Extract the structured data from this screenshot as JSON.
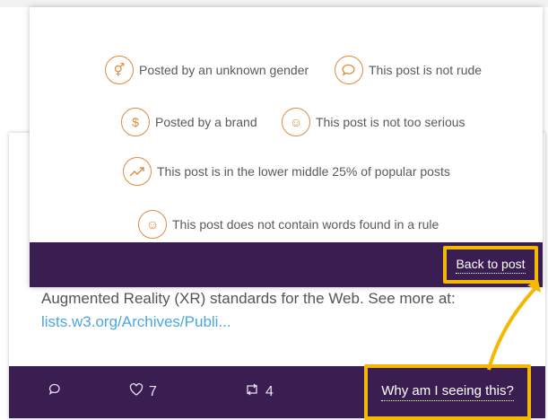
{
  "reasons": {
    "gender": "Posted by an unknown gender",
    "rude": "This post is not rude",
    "brand": "Posted by a brand",
    "serious": "This post is not too serious",
    "popular": "This post is in the lower middle 25% of popular posts",
    "rule": "This post does not contain words found in a rule"
  },
  "modal": {
    "back_label": "Back to post"
  },
  "post": {
    "text_line": "Augmented Reality (XR) standards for the Web. See more at:",
    "link": "lists.w3.org/Archives/Publi..."
  },
  "footer": {
    "like_count": "7",
    "repost_count": "4",
    "why_label": "Why am I seeing this?"
  },
  "icons": {
    "gender": "gender-symbols-icon",
    "rude": "speech-bubble-icon",
    "brand": "dollar-icon",
    "serious": "jester-face-icon",
    "popular": "trend-up-icon",
    "rule": "jester-face-icon",
    "comment": "comment-icon",
    "like": "heart-icon",
    "repost": "repost-icon"
  },
  "colors": {
    "accent": "#e08a3c",
    "footer": "#3a1e52",
    "highlight": "#f5b800",
    "link": "#4aa8e0"
  }
}
